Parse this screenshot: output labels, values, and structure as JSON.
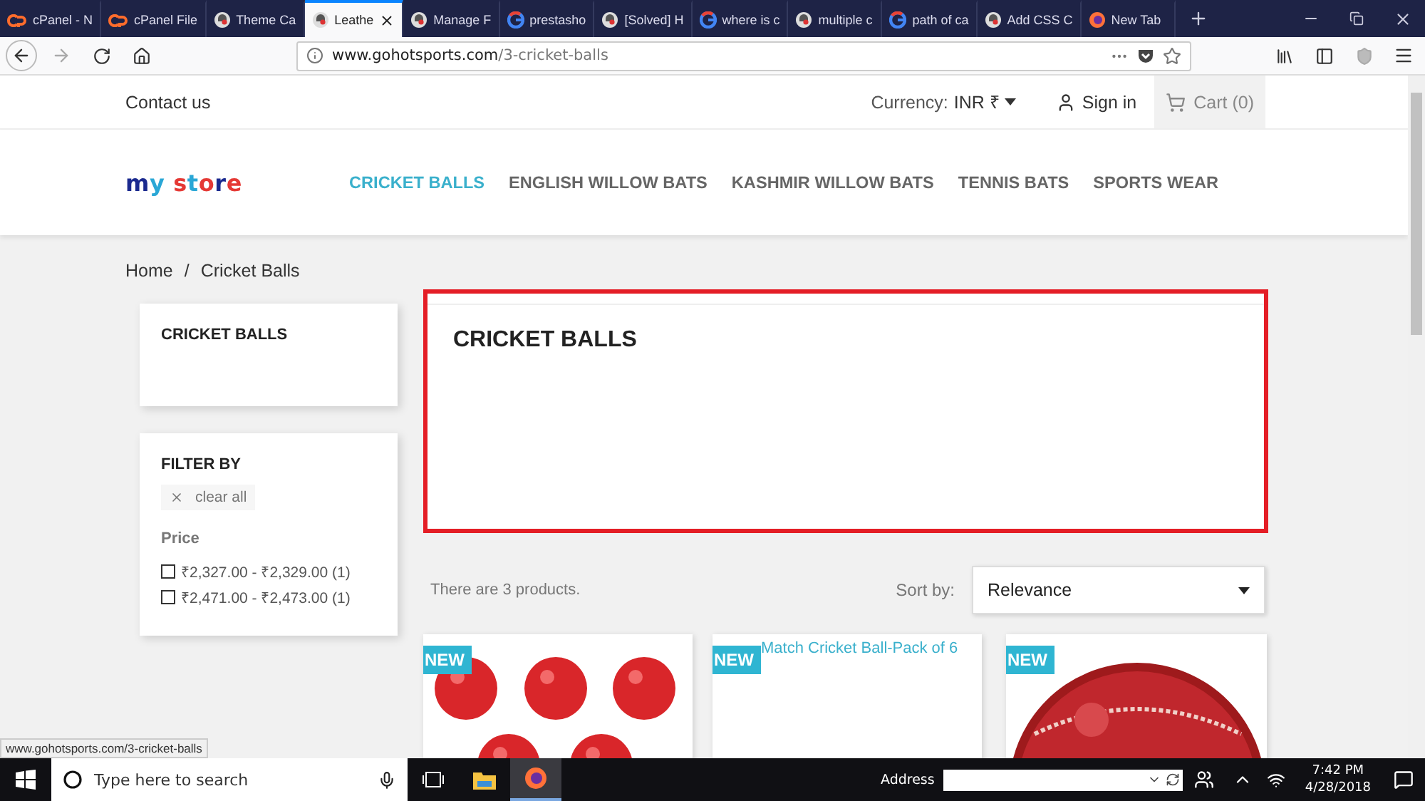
{
  "browser": {
    "tabs": [
      {
        "label": "cPanel - N",
        "kind": "cpanel",
        "selected": false
      },
      {
        "label": "cPanel File",
        "kind": "cpanel",
        "selected": false
      },
      {
        "label": "Theme Ca",
        "kind": "puffin",
        "selected": false
      },
      {
        "label": "Leathe",
        "kind": "puffin",
        "selected": true
      },
      {
        "label": "Manage F",
        "kind": "puffin",
        "selected": false
      },
      {
        "label": "prestasho",
        "kind": "google",
        "selected": false
      },
      {
        "label": "[Solved] H",
        "kind": "puffin",
        "selected": false
      },
      {
        "label": "where is c",
        "kind": "google",
        "selected": false
      },
      {
        "label": "multiple c",
        "kind": "puffin",
        "selected": false
      },
      {
        "label": "path of ca",
        "kind": "google",
        "selected": false
      },
      {
        "label": "Add CSS C",
        "kind": "puffin",
        "selected": false
      },
      {
        "label": "New Tab",
        "kind": "firefox",
        "selected": false
      }
    ],
    "url": {
      "host": "www.gohotsports.com",
      "path": "/3-cricket-balls"
    },
    "status_url": "www.gohotsports.com/3-cricket-balls"
  },
  "page": {
    "top_nav": {
      "contact": "Contact us",
      "currency_label": "Currency:",
      "currency_value": "INR ₹",
      "sign_in": "Sign in",
      "cart": "Cart (0)"
    },
    "logo": "my store",
    "menu": [
      {
        "label": "CRICKET BALLS",
        "selected": true
      },
      {
        "label": "ENGLISH WILLOW BATS",
        "selected": false
      },
      {
        "label": "KASHMIR WILLOW BATS",
        "selected": false
      },
      {
        "label": "TENNIS BATS",
        "selected": false
      },
      {
        "label": "SPORTS WEAR",
        "selected": false
      }
    ],
    "breadcrumb": [
      "Home",
      "Cricket Balls"
    ],
    "breadcrumb_separator": "/",
    "sidebar": {
      "category_title": "CRICKET BALLS",
      "filter": {
        "title": "FILTER BY",
        "clear": "clear all",
        "facet": "Price",
        "options": [
          {
            "label": "₹2,327.00 - ₹2,329.00 (1)",
            "checked": false
          },
          {
            "label": "₹2,471.00 - ₹2,473.00 (1)",
            "checked": false
          }
        ]
      }
    },
    "category": {
      "title": "CRICKET BALLS"
    },
    "listing": {
      "count": "There are 3 products.",
      "sort_label": "Sort by:",
      "sort_value": "Relevance"
    },
    "products": [
      {
        "badge": "NEW",
        "kind": "balls"
      },
      {
        "badge": "NEW",
        "kind": "title",
        "title": "Match Cricket Ball-Pack of 6"
      },
      {
        "badge": "NEW",
        "kind": "ball"
      }
    ]
  },
  "taskbar": {
    "search_placeholder": "Type here to search",
    "address_label": "Address",
    "time": "7:42 PM",
    "date": "4/28/2018"
  }
}
